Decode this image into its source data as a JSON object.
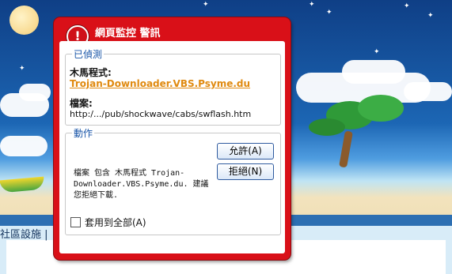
{
  "background": {
    "bottom_text": "社區設施 | "
  },
  "dialog": {
    "title": "網頁監控 警訊",
    "detected": {
      "legend": "已偵測",
      "trojan_label": "木馬程式:",
      "trojan_name": "Trojan-Downloader.VBS.Psyme.du",
      "file_label": "檔案:",
      "file_path": "http:/.../pub/shockwave/cabs/swflash.htm"
    },
    "action": {
      "legend": "動作",
      "description": "檔案 包含 木馬程式 Trojan-\nDownloader.VBS.Psyme.du. 建議\n您拒絕下載.",
      "allow_label": "允許(A)",
      "deny_label": "拒絕(N)",
      "apply_all_label": "套用到全部(A)",
      "apply_all_checked": false
    }
  },
  "colors": {
    "dialog_red": "#d91018",
    "legend_blue": "#1a56a8",
    "link_orange": "#e08a10"
  }
}
